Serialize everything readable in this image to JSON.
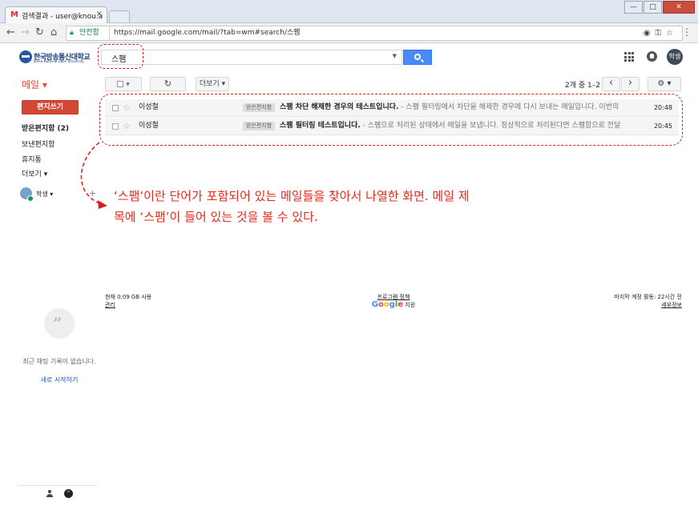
{
  "browser": {
    "tab_title": "검색결과 - user@knou.a",
    "tab_icon": "M",
    "secure_label": "안전함",
    "url": "https://mail.google.com/mail/?tab=wm#search/스팸",
    "window_buttons": [
      "—",
      "□",
      "✕"
    ]
  },
  "header": {
    "logo_text": "한국방송통신대학교",
    "logo_sub": "Korea National Open University",
    "search_query": "스팸",
    "avatar_text": "학생"
  },
  "toolbar": {
    "mail_label": "메일 ▾",
    "refresh_icon": "↻",
    "more_label": "더보기 ▾",
    "pager_count": "2개 중 1–2",
    "prev": "‹",
    "next": "›",
    "settings_icon": "⚙ ▾"
  },
  "sidebar": {
    "compose_label": "편지쓰기",
    "items": [
      {
        "label": "받은편지함 (2)",
        "bold": true
      },
      {
        "label": "보낸편지함",
        "bold": false
      },
      {
        "label": "휴지통",
        "bold": false
      },
      {
        "label": "더보기 ▾",
        "bold": false
      }
    ],
    "user_name": "학생 ▾",
    "add": "+",
    "no_chat": "최근 채팅 기록이 없습니다.",
    "start_new": "새로 시작하기"
  },
  "messages": [
    {
      "sender": "이성철",
      "label": "받은편지함",
      "subject": "스팸 차단 해제한 경우의 테스트입니다.",
      "snippet": " - 스팸 필터링에서 차단을 해제한 경우에 다시 보내는 메일입니다. 이번의",
      "time": "20:48"
    },
    {
      "sender": "이성철",
      "label": "받은편지함",
      "subject": "스팸 필터링 테스트입니다.",
      "snippet": " - 스팸으로 처리된 상태에서 메일을 보냅니다. 정상적으로 처리된다면 스팸함으로 전달",
      "time": "20:45"
    }
  ],
  "annotation": "‘스팸’이란 단어가 포함되어 있는 메일들을 찾아서 나열한 화면.  메일 제\n목에 ‘스팸’이 들어 있는 것을 볼 수 있다.",
  "footer": {
    "usage": "현재 0.09 GB 사용",
    "manage": "관리",
    "program_policy": "프로그램 정책",
    "google": "Google",
    "powered": "지원",
    "last_activity": "마지막 계정 활동: 22시간 전",
    "details": "세부정보"
  },
  "colors": {
    "annotation_red": "#e42a1c",
    "compose_red": "#d14836",
    "search_blue": "#4a8af4"
  }
}
